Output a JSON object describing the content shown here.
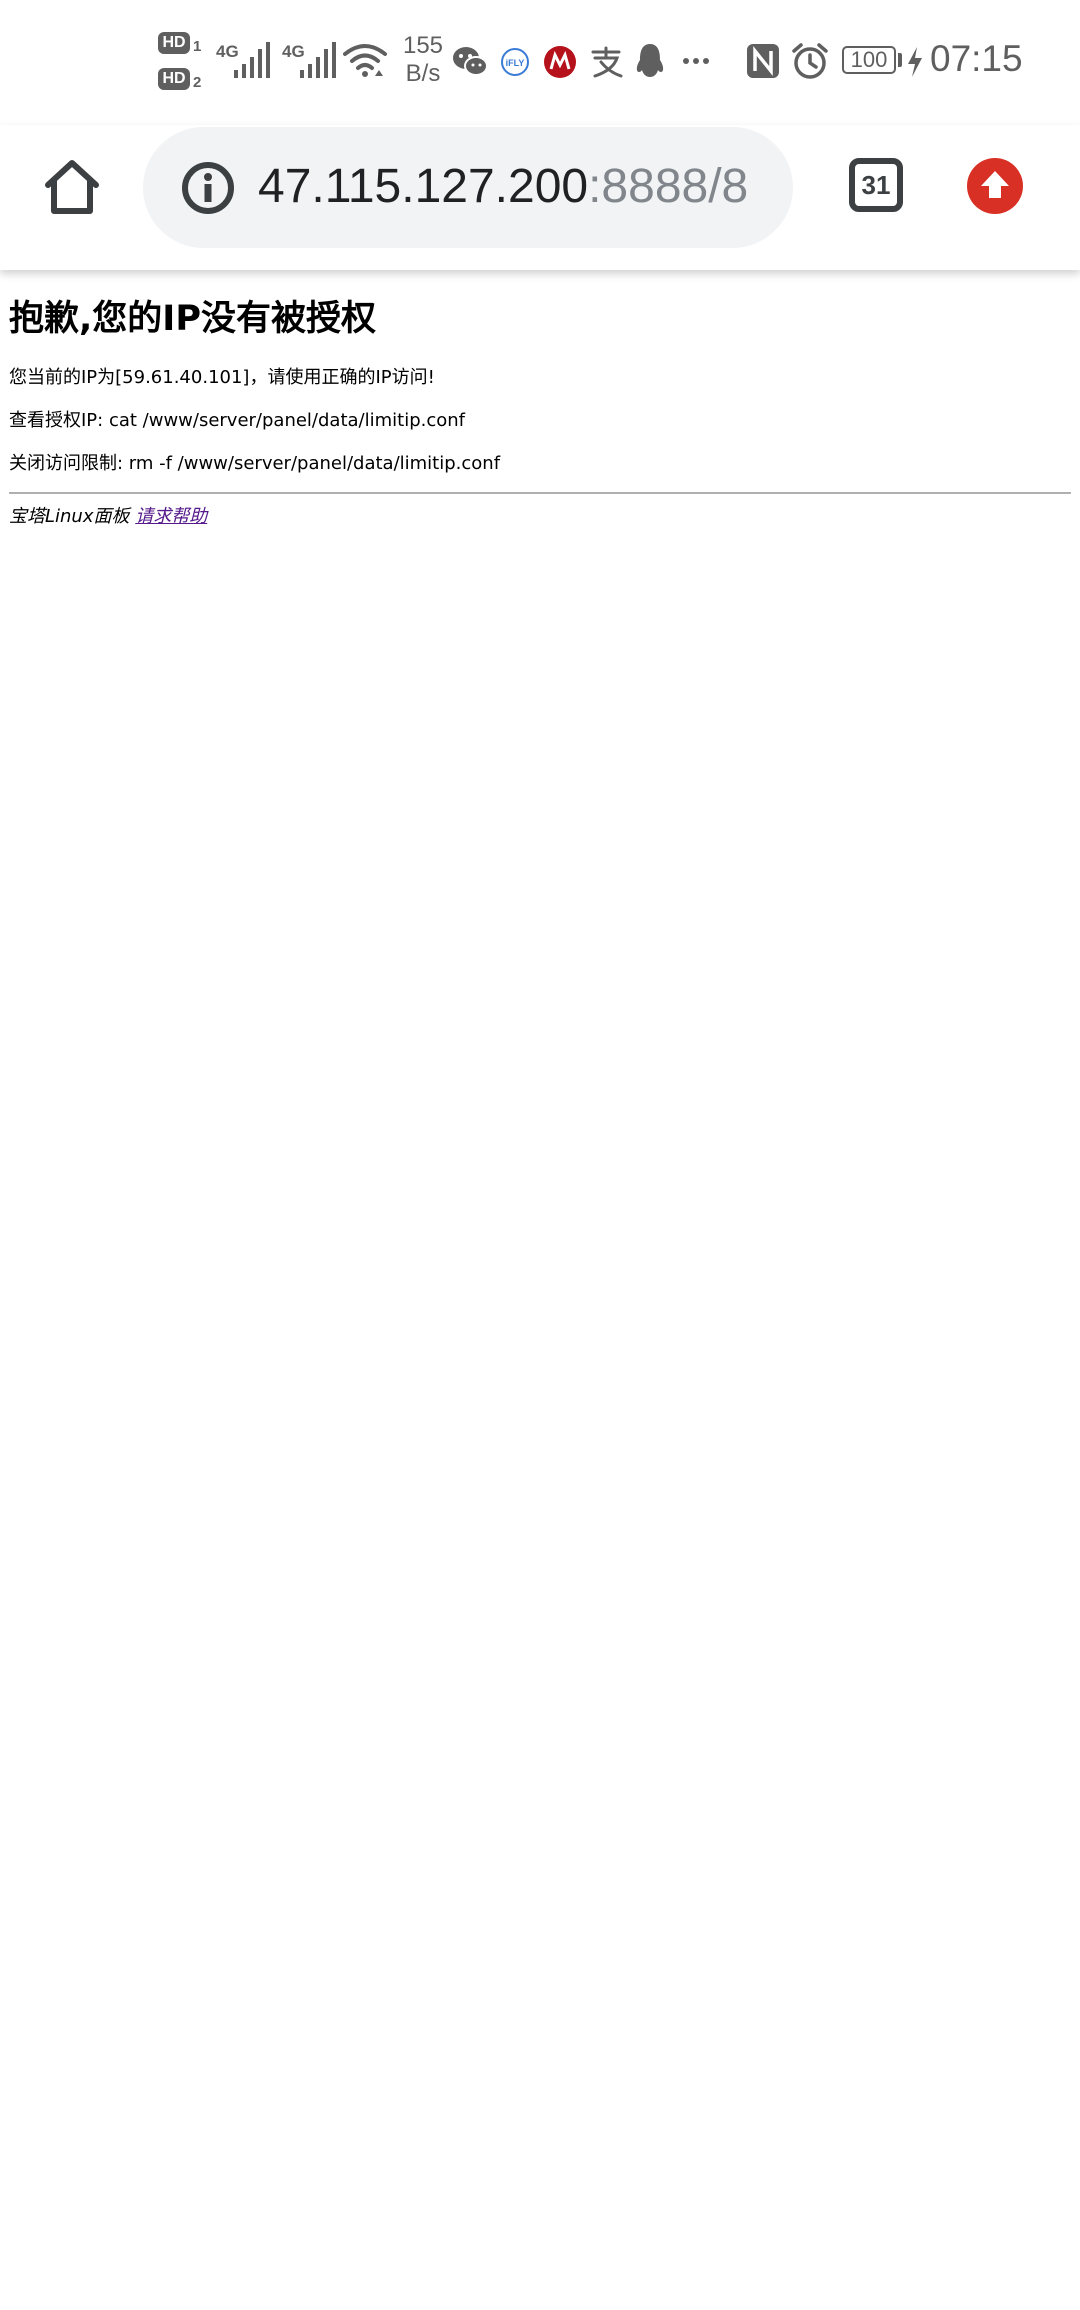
{
  "status_bar": {
    "sim1_label": "HD",
    "sim1_index": "1",
    "sim2_label": "HD",
    "sim2_index": "2",
    "network1": "4G",
    "network2": "4G",
    "speed_value": "155",
    "speed_unit": "B/s",
    "battery": "100",
    "time": "07:15",
    "icons": [
      "hd-icon",
      "signal-icon",
      "signal-icon",
      "wifi-icon",
      "wechat-icon",
      "ifly-icon",
      "cmb-icon",
      "alipay-icon",
      "qq-icon",
      "more-icon",
      "nfc-icon",
      "alarm-icon",
      "battery-icon",
      "charging-icon"
    ]
  },
  "toolbar": {
    "url_host": "47.115.127.200",
    "url_rest": ":8888/8",
    "tab_count": "31",
    "icons": [
      "home-icon",
      "info-icon",
      "tab-switcher-icon",
      "update-icon"
    ]
  },
  "page": {
    "title": "抱歉,您的IP没有被授权",
    "line1": "您当前的IP为[59.61.40.101]，请使用正确的IP访问!",
    "line2": "查看授权IP: cat /www/server/panel/data/limitip.conf",
    "line3": "关闭访问限制: rm -f /www/server/panel/data/limitip.conf",
    "footer_prefix": "宝塔Linux面板",
    "help_link": "请求帮助"
  },
  "colors": {
    "status_text": "#5f5f5f",
    "omnibox_bg": "#f1f3f4",
    "url_host": "#202124",
    "url_rest": "#80868b",
    "update_red": "#d93025",
    "link_visited": "#551a8b",
    "rule": "#b0b0b0"
  }
}
